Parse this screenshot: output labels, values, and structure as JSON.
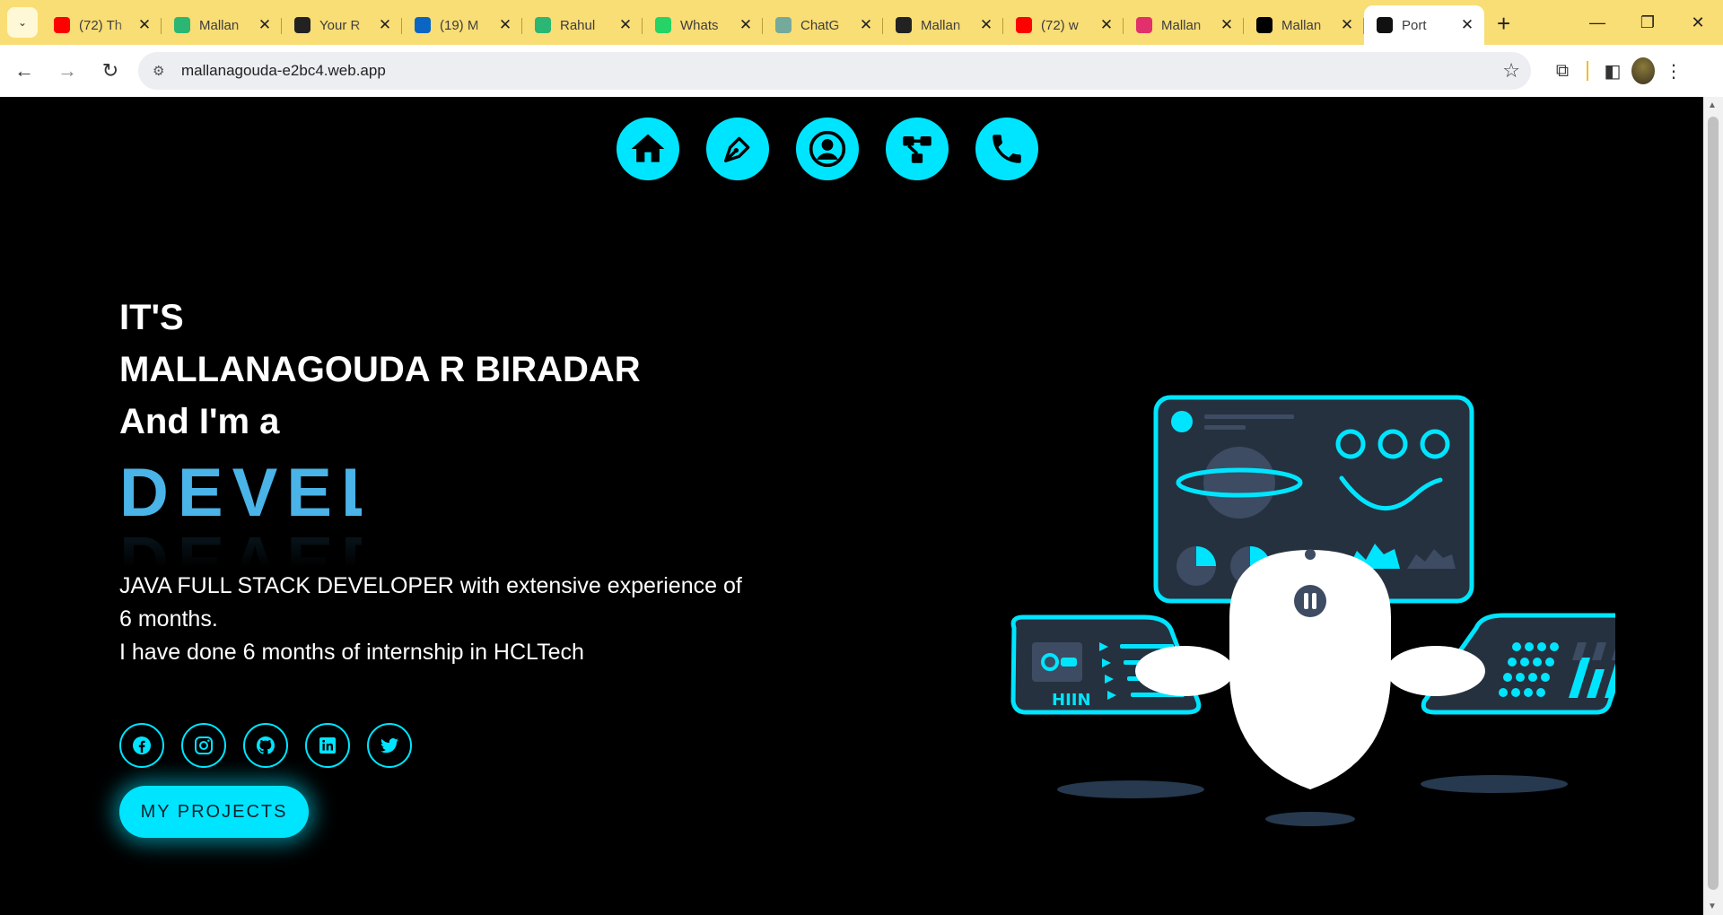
{
  "browser": {
    "tabs": [
      {
        "label": "(72) Th",
        "icon": "youtube-icon",
        "color": "#ff0000"
      },
      {
        "label": "Mallan",
        "icon": "app-icon",
        "color": "#2bb673"
      },
      {
        "label": "Your R",
        "icon": "github-icon",
        "color": "#222222"
      },
      {
        "label": "(19) M",
        "icon": "linkedin-icon",
        "color": "#0a66c2"
      },
      {
        "label": "Rahul",
        "icon": "app-icon",
        "color": "#2bb673"
      },
      {
        "label": "Whats",
        "icon": "whatsapp-icon",
        "color": "#25d366"
      },
      {
        "label": "ChatG",
        "icon": "chatgpt-icon",
        "color": "#74aa9c"
      },
      {
        "label": "Mallan",
        "icon": "github-icon",
        "color": "#222222"
      },
      {
        "label": "(72) w",
        "icon": "youtube-icon",
        "color": "#ff0000"
      },
      {
        "label": "Mallan",
        "icon": "instagram-icon",
        "color": "#e1306c"
      },
      {
        "label": "Mallan",
        "icon": "x-icon",
        "color": "#000000"
      },
      {
        "label": "Port",
        "icon": "angular-icon",
        "color": "#111111",
        "active": true
      }
    ],
    "url": "mallanagouda-e2bc4.web.app"
  },
  "nav": {
    "icons": [
      "home-icon",
      "pen-icon",
      "user-icon",
      "network-icon",
      "phone-icon"
    ]
  },
  "hero": {
    "line1": "IT'S",
    "line2": "MALLANAGOUDA R BIRADAR",
    "line3": "And I'm a",
    "role": "DEVELOPER",
    "description": "JAVA FULL STACK DEVELOPER with extensive experience of 6 months.",
    "internship": "I have done 6 months of internship in HCLTech",
    "social": [
      "facebook-icon",
      "instagram-icon",
      "github-icon",
      "linkedin-icon",
      "twitter-icon"
    ],
    "button": "MY PROJECTS"
  },
  "colors": {
    "accent": "#00e5ff",
    "role": "#4ab3e8",
    "panel": "#26313f"
  }
}
